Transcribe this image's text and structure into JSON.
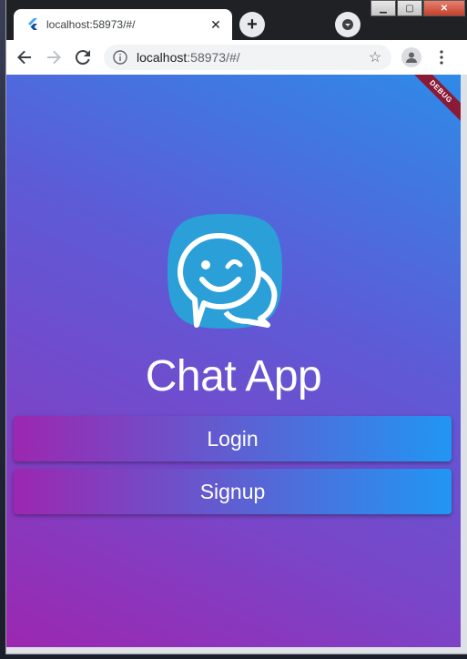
{
  "browser": {
    "tab_title": "localhost:58973/#/",
    "url_host": "localhost",
    "url_rest": ":58973/#/",
    "new_tab_label": "+",
    "close_tab_label": "✕"
  },
  "app": {
    "debug_banner": "DEBUG",
    "title": "Chat App",
    "login_label": "Login",
    "signup_label": "Signup"
  },
  "colors": {
    "gradient_start": "#9c27b0",
    "gradient_end": "#2196f3",
    "logo_bg": "#2a9fd8",
    "debug_ribbon": "#8a1a35"
  },
  "icons": [
    "flutter-icon",
    "close-icon",
    "plus-icon",
    "tab-search-icon",
    "back-icon",
    "forward-icon",
    "reload-icon",
    "info-icon",
    "star-icon",
    "profile-icon",
    "more-menu-icon",
    "chat-logo-icon"
  ]
}
